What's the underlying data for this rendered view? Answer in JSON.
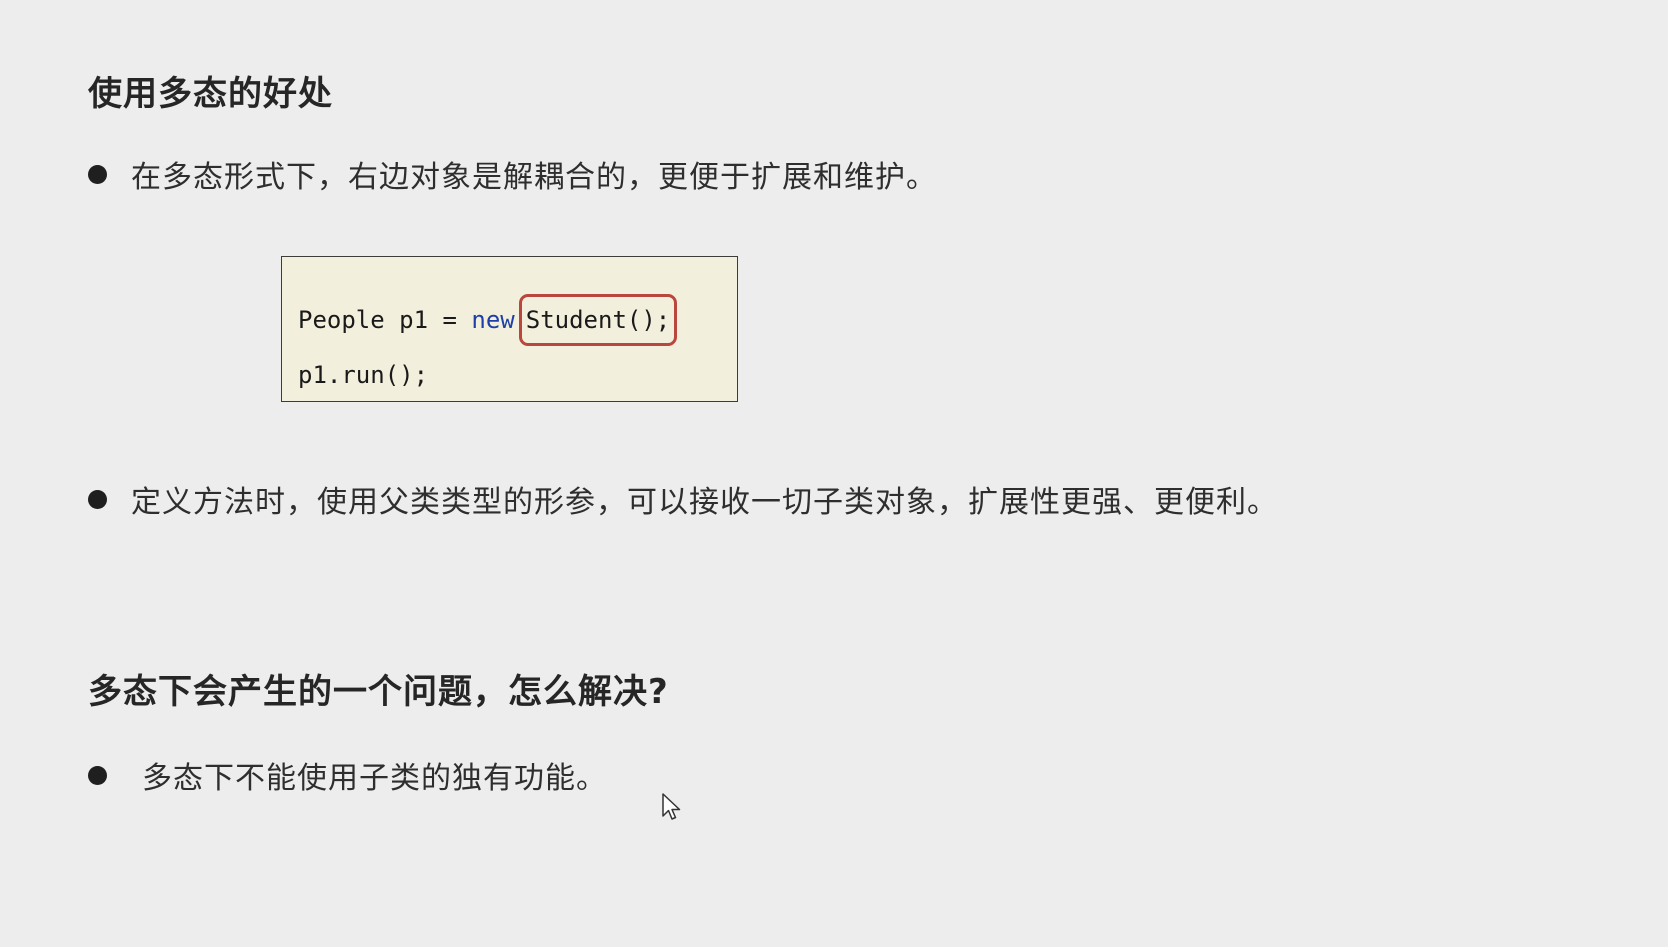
{
  "section1": {
    "title": "使用多态的好处",
    "bullets": [
      "在多态形式下，右边对象是解耦合的，更便于扩展和维护。",
      "定义方法时，使用父类类型的形参，可以接收一切子类对象，扩展性更强、更便利。"
    ],
    "code": {
      "line1_prefix": "People p1 = ",
      "line1_keyword": "new",
      "line1_highlight": "Student();",
      "line2": "p1.run();"
    }
  },
  "section2": {
    "title": "多态下会产生的一个问题，怎么解决?",
    "bullets": [
      "多态下不能使用子类的独有功能。"
    ]
  },
  "colors": {
    "background": "#ededed",
    "code_background": "#f2f0dc",
    "keyword": "#1f3fa8",
    "highlight_border": "#b9473d"
  },
  "icons": {
    "cursor": "mouse-pointer-icon",
    "bullet": "bullet-dot-icon"
  }
}
